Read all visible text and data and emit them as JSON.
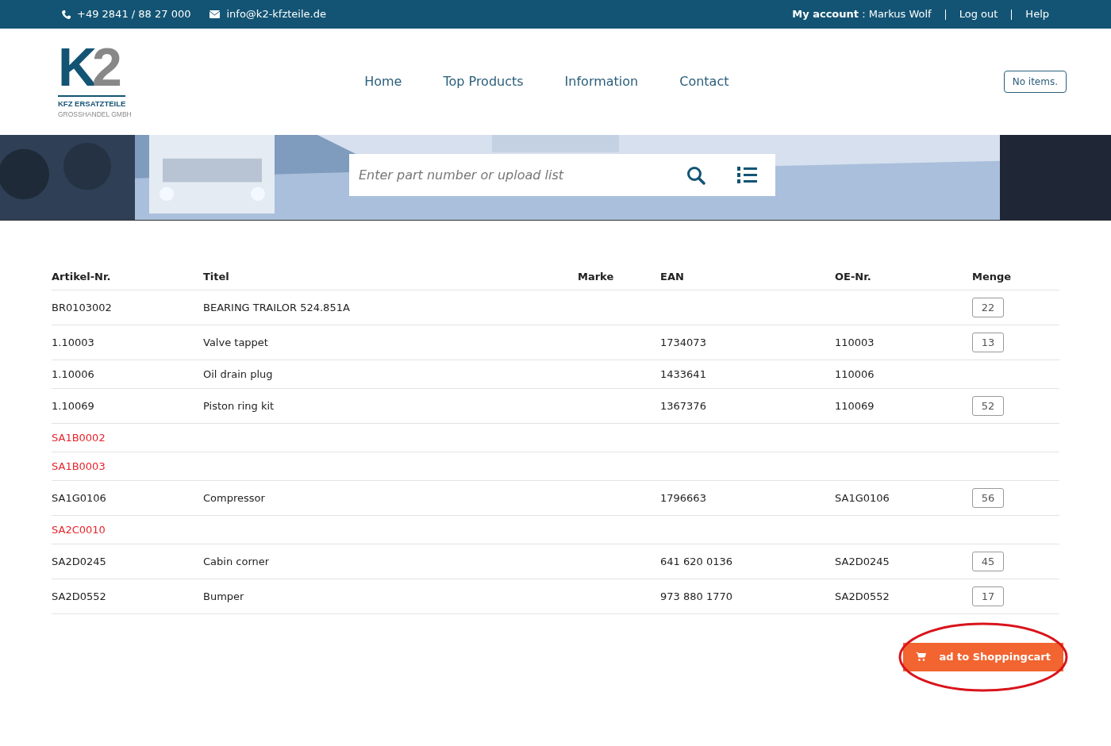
{
  "topbar": {
    "phone": "+49 2841 / 88 27 000",
    "email": "info@k2-kfzteile.de",
    "account_label": "My account",
    "account_name": " : Markus Wolf",
    "links": [
      "Log out",
      "Help"
    ]
  },
  "logo": {
    "mark_letter": "K",
    "mark_digit": "2",
    "line1": "KFZ ERSATZTEILE",
    "line2": "GROSSHANDEL GMBH"
  },
  "nav": [
    "Home",
    "Top Products",
    "Information",
    "Contact"
  ],
  "cart": {
    "label": "No items."
  },
  "search": {
    "placeholder": "Enter part number or upload list"
  },
  "table": {
    "columns": [
      "Artikel-Nr.",
      "Titel",
      "Marke",
      "EAN",
      "OE-Nr.",
      "Menge"
    ],
    "rows": [
      {
        "found": true,
        "article": "BR0103002",
        "title": "BEARING TRAILOR 524.851A",
        "quantity": "22"
      },
      {
        "found": true,
        "article": "1.10003",
        "title": "Valve tappet",
        "ean": "1734073",
        "oe": "110003",
        "quantity": "13"
      },
      {
        "found": true,
        "article": "1.10006",
        "title": "Oil drain plug",
        "ean": "1433641",
        "oe": "110006"
      },
      {
        "found": true,
        "article": "1.10069",
        "title": "Piston ring kit",
        "ean": "1367376",
        "oe": "110069",
        "quantity": "52"
      },
      {
        "found": false,
        "article": "SA1B0002"
      },
      {
        "found": false,
        "article": "SA1B0003"
      },
      {
        "found": true,
        "article": "SA1G0106",
        "title": "Compressor",
        "ean": "1796663",
        "oe": "SA1G0106",
        "quantity": "56"
      },
      {
        "found": false,
        "article": "SA2C0010"
      },
      {
        "found": true,
        "article": "SA2D0245",
        "title": "Cabin corner",
        "ean": "641 620 0136",
        "oe": "SA2D0245",
        "quantity": "45"
      },
      {
        "found": true,
        "article": "SA2D0552",
        "title": "Bumper",
        "ean": "973 880 1770",
        "oe": "SA2D0552",
        "quantity": "17"
      }
    ]
  },
  "add_button": {
    "label": "ad to Shoppingcart",
    "highlighted": true
  }
}
